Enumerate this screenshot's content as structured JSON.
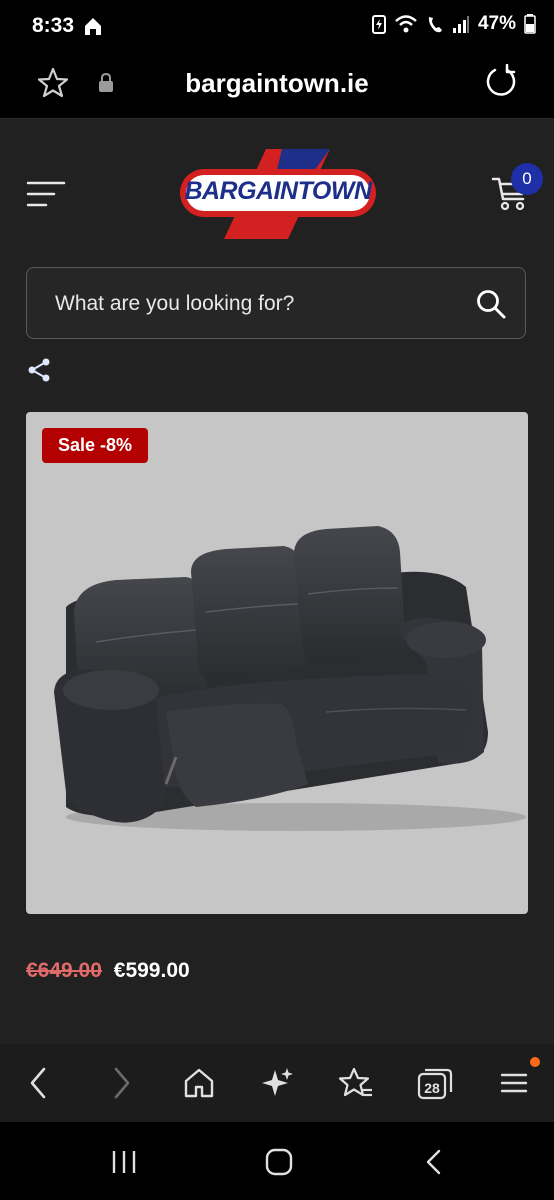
{
  "status": {
    "time": "8:33",
    "battery": "47%"
  },
  "browser": {
    "url": "bargaintown.ie"
  },
  "header": {
    "logo_text": "BARGAINTOWN",
    "cart_count": "0"
  },
  "search": {
    "placeholder": "What are you looking for?"
  },
  "product": {
    "badge": "Sale -8%",
    "old_price": "€649.00",
    "new_price": "€599.00"
  },
  "nav": {
    "tabs_count": "28"
  },
  "colors": {
    "sale_red": "#b30000",
    "cart_badge": "#1f2fa8",
    "old_price": "#e06a6a"
  }
}
